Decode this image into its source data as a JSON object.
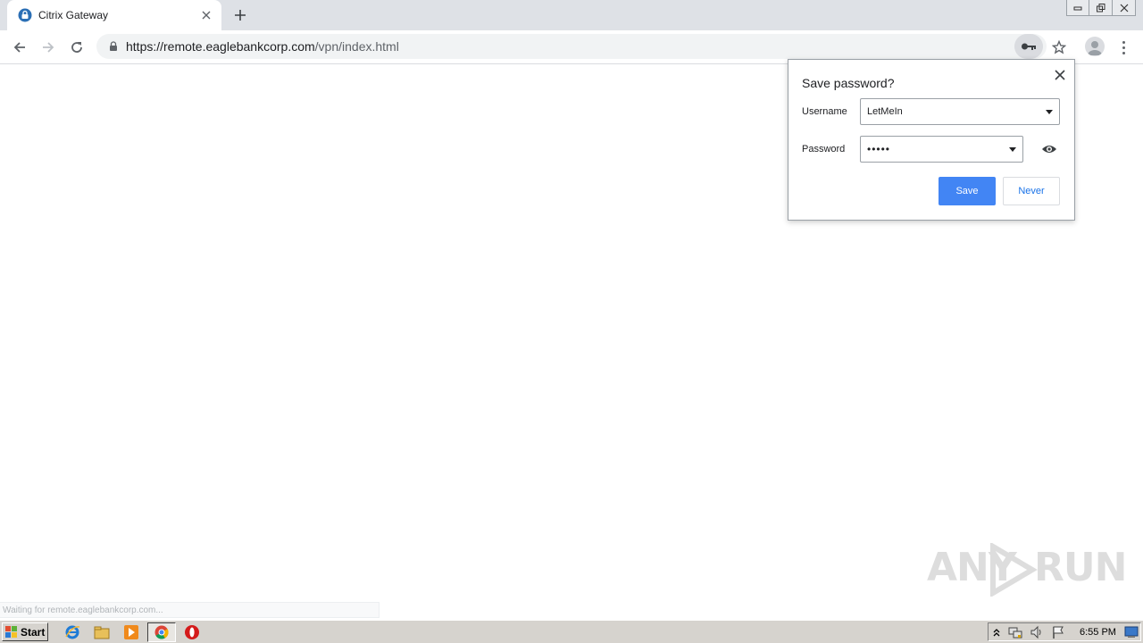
{
  "browser": {
    "tab": {
      "title": "Citrix Gateway"
    },
    "url": {
      "host_part": "https://remote.eaglebankcorp.com",
      "path_part": "/vpn/index.html"
    }
  },
  "password_bubble": {
    "title": "Save password?",
    "username_label": "Username",
    "username_value": "LetMeIn",
    "password_label": "Password",
    "password_value": "•••••",
    "save_label": "Save",
    "never_label": "Never"
  },
  "status_bar": {
    "text": "Waiting for remote.eaglebankcorp.com..."
  },
  "watermark": {
    "text": "ANY RUN"
  },
  "taskbar": {
    "start_label": "Start",
    "clock": "6:55 PM",
    "icons": [
      "internet-explorer-icon",
      "explorer-icon",
      "media-player-icon",
      "chrome-icon",
      "opera-icon"
    ]
  },
  "colors": {
    "accent": "#4285f4",
    "tabstrip": "#dee1e6",
    "taskbar": "#d6d3ce"
  }
}
